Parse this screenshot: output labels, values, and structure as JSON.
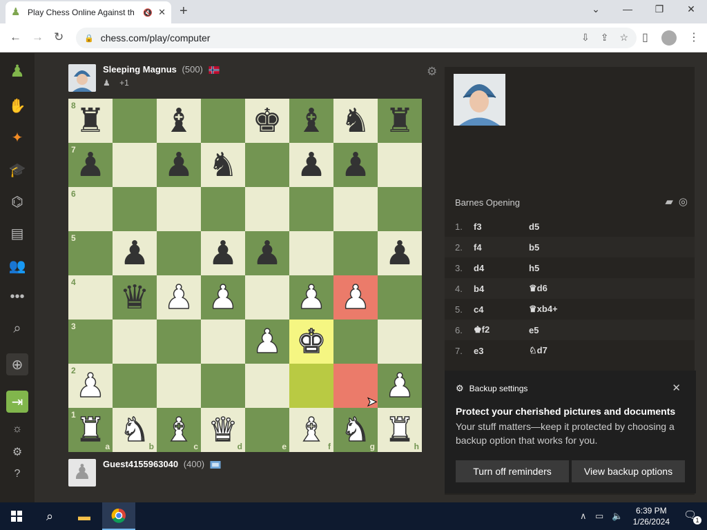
{
  "browser": {
    "tab_title": "Play Chess Online Against th",
    "url": "chess.com/play/computer"
  },
  "top_player": {
    "name": "Sleeping Magnus",
    "rating": "(500)",
    "sub": "+1"
  },
  "bottom_player": {
    "name": "Guest4155963040",
    "rating": "(400)"
  },
  "board": {
    "ranks": [
      "8",
      "7",
      "6",
      "5",
      "4",
      "3",
      "2",
      "1"
    ],
    "files": [
      "a",
      "b",
      "c",
      "d",
      "e",
      "f",
      "g",
      "h"
    ],
    "rows": [
      [
        "r",
        "",
        "b",
        "",
        "k",
        "b",
        "n",
        "r"
      ],
      [
        "p",
        "",
        "p",
        "n",
        "",
        "p",
        "p",
        ""
      ],
      [
        "",
        "",
        "",
        "",
        "",
        "",
        "",
        ""
      ],
      [
        "",
        "p",
        "",
        "p",
        "p",
        "",
        "",
        "p"
      ],
      [
        "",
        "q",
        "P",
        "P",
        "",
        "P",
        "P",
        ""
      ],
      [
        "",
        "",
        "",
        "",
        "P",
        "K",
        "",
        ""
      ],
      [
        "P",
        "",
        "",
        "",
        "",
        "",
        "",
        "P"
      ],
      [
        "R",
        "N",
        "B",
        "Q",
        "",
        "B",
        "N",
        "R"
      ]
    ],
    "highlights": {
      "yellow": [
        "f3",
        "f2"
      ],
      "red": [
        "g4",
        "g2"
      ]
    }
  },
  "panel": {
    "opening": "Barnes Opening",
    "moves": [
      {
        "num": "1.",
        "white": "f3",
        "black": "d5"
      },
      {
        "num": "2.",
        "white": "f4",
        "black": "b5"
      },
      {
        "num": "3.",
        "white": "d4",
        "black": "h5"
      },
      {
        "num": "4.",
        "white": "b4",
        "black": "♛d6"
      },
      {
        "num": "5.",
        "white": "c4",
        "black": "♛xb4+"
      },
      {
        "num": "6.",
        "white": "♚f2",
        "black": "e5"
      },
      {
        "num": "7.",
        "white": "e3",
        "black": "♘d7"
      }
    ]
  },
  "toast": {
    "header": "Backup settings",
    "title": "Protect your cherished pictures and documents",
    "body": "Your stuff matters—keep it protected by choosing a backup option that works for you.",
    "btn_off": "Turn off reminders",
    "btn_view": "View backup options"
  },
  "taskbar": {
    "time": "6:39 PM",
    "date": "1/26/2024",
    "notif_count": "1"
  }
}
